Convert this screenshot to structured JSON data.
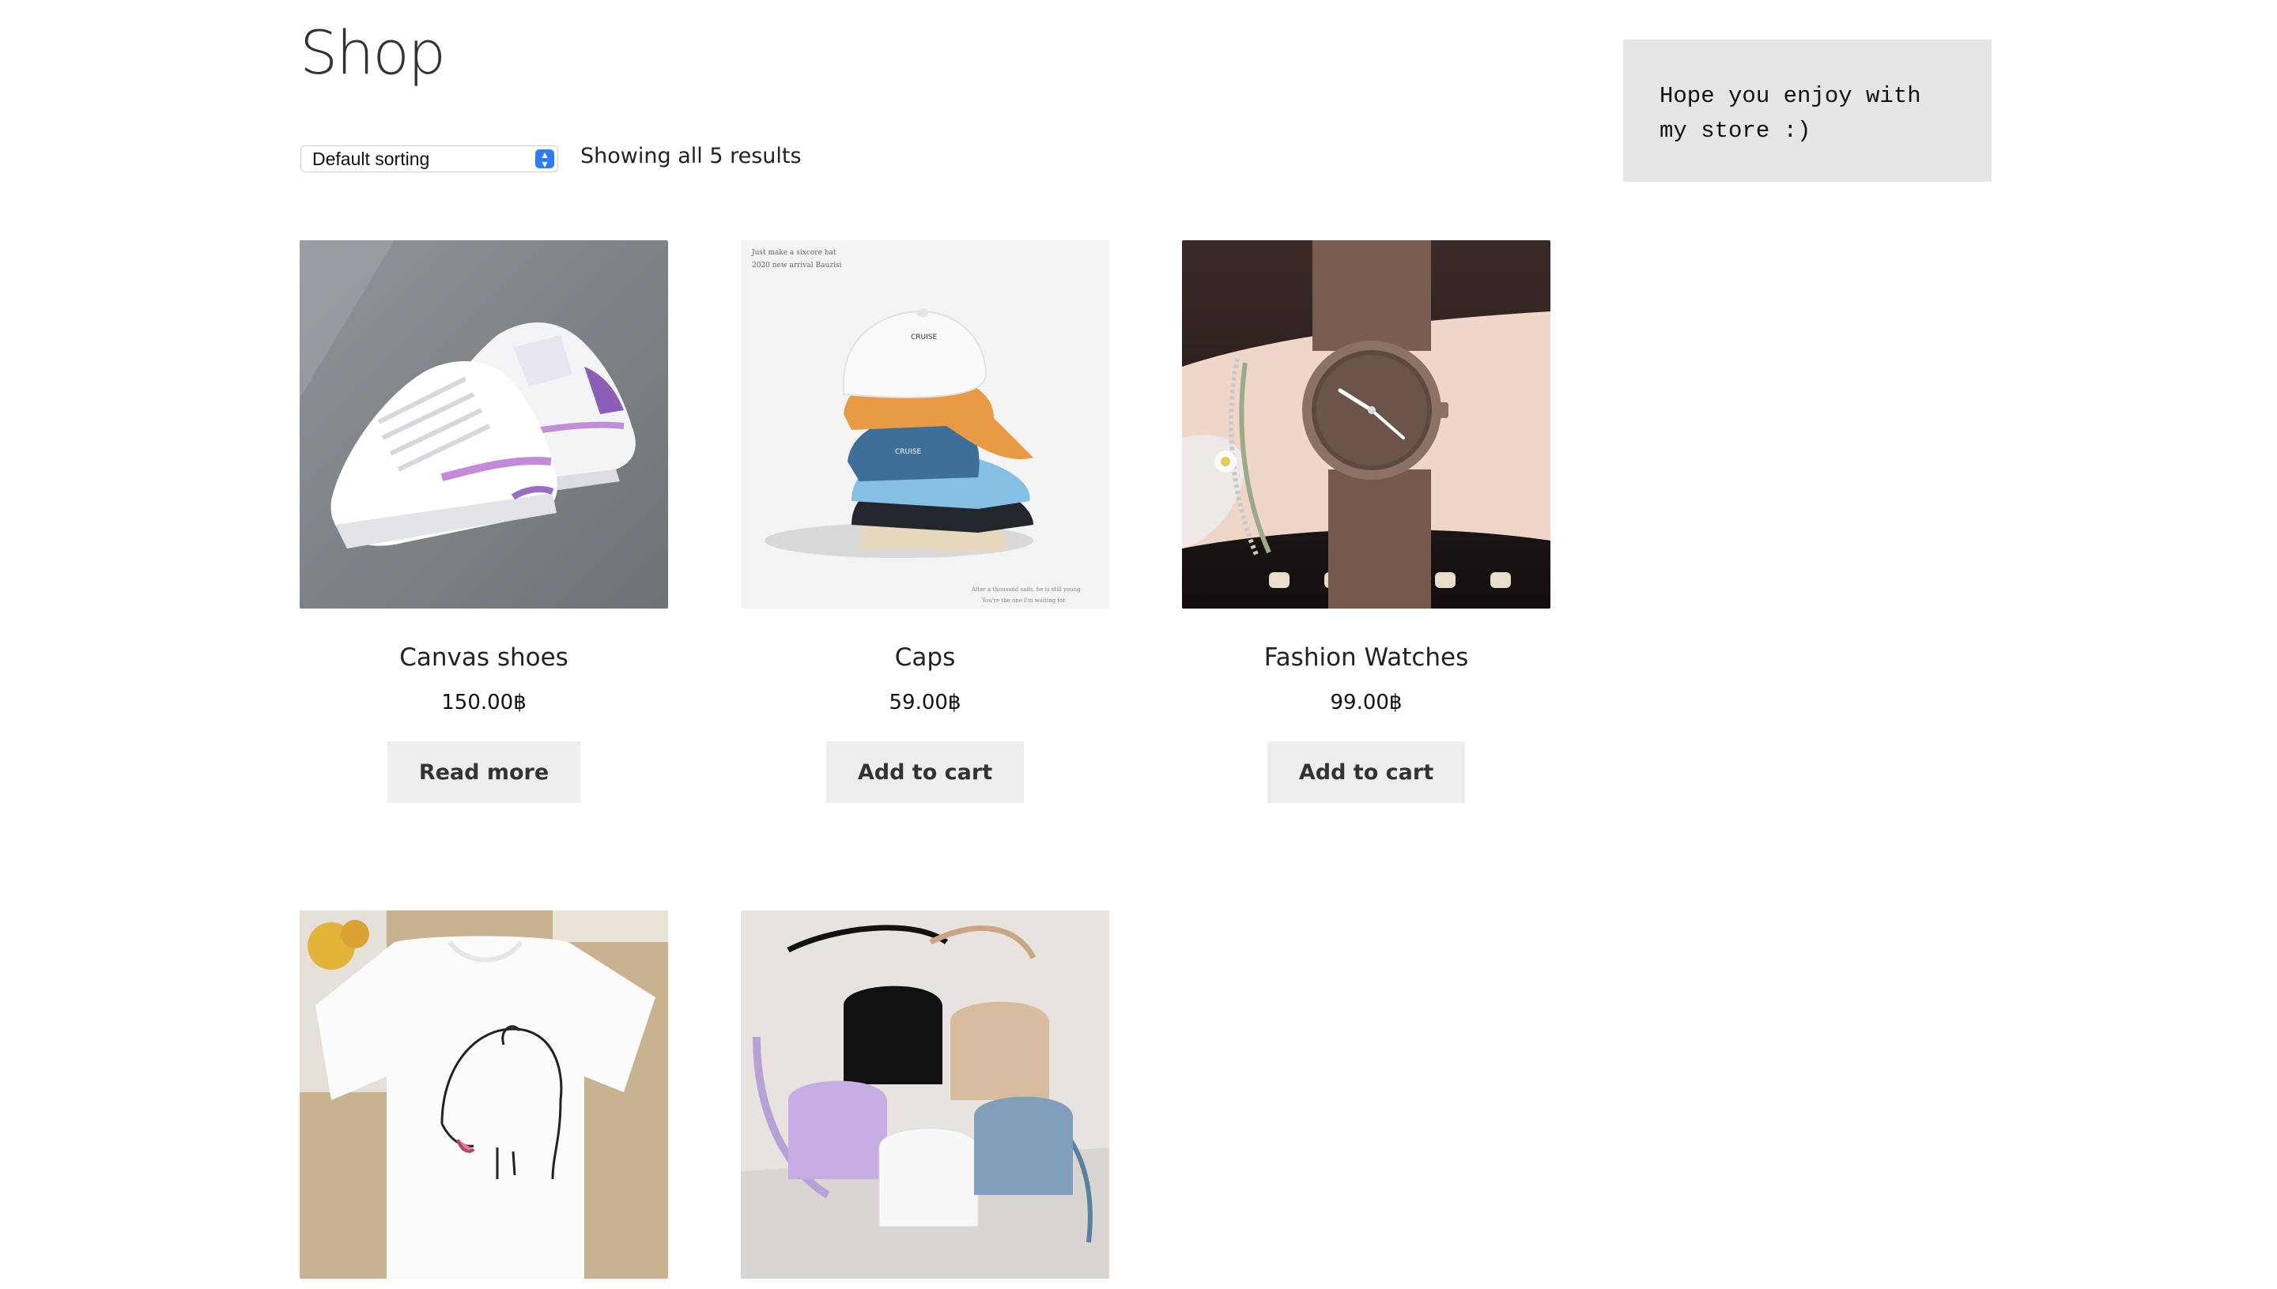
{
  "page_title": "Shop",
  "sorting": {
    "selected": "Default sorting"
  },
  "result_count": "Showing all 5 results",
  "widget": {
    "text": "Hope you enjoy with my store :)"
  },
  "products": [
    {
      "title": "Canvas shoes",
      "price": "150.00฿",
      "button": "Read more",
      "image": "white-sneakers-photo"
    },
    {
      "title": "Caps",
      "price": "59.00฿",
      "button": "Add to cart",
      "image": "stacked-caps-photo",
      "image_text": [
        "Just make a sixcore hat",
        "2020 new arrival Bauzisi",
        "CRUISE",
        "After a thousand sails, he is still young",
        "You're the one I'm waiting for"
      ]
    },
    {
      "title": "Fashion Watches",
      "price": "99.00฿",
      "button": "Add to cart",
      "image": "wrist-watch-photo"
    },
    {
      "image": "white-tshirt-photo"
    },
    {
      "image": "crossbody-bags-photo"
    }
  ],
  "colors": {
    "button_bg": "#eeeeee",
    "widget_bg": "#e6e6e6",
    "select_accent": "#2f7df6"
  }
}
